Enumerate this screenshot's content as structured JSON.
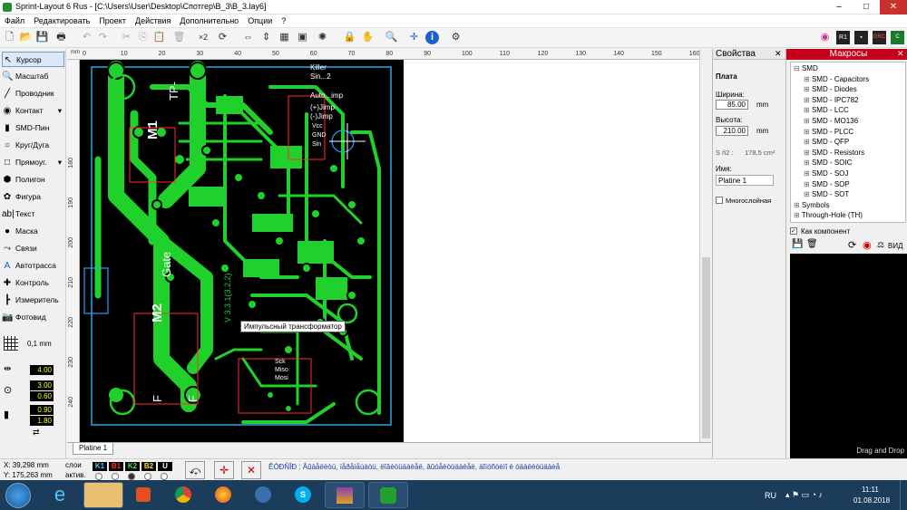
{
  "window": {
    "title": "Sprint-Layout 6 Rus - [C:\\Users\\User\\Desktop\\Спотгер\\B_3\\B_3.lay6]"
  },
  "menu": [
    "Файл",
    "Редактировать",
    "Проект",
    "Действия",
    "Дополнительно",
    "Опции",
    "?"
  ],
  "toolbar": {
    "repeat_label": "×2"
  },
  "tools": [
    {
      "label": "Курсор",
      "icon": "cursor-icon",
      "glyph": "↖"
    },
    {
      "label": "Масштаб",
      "icon": "zoom-icon",
      "glyph": "🔍"
    },
    {
      "label": "Проводник",
      "icon": "track-icon",
      "glyph": "╱"
    },
    {
      "label": "Контакт",
      "icon": "pad-icon",
      "glyph": "◉"
    },
    {
      "label": "SMD-Пин",
      "icon": "smd-pin-icon",
      "glyph": "▮"
    },
    {
      "label": "Круг/Дуга",
      "icon": "circle-icon",
      "glyph": "○"
    },
    {
      "label": "Прямоуг.",
      "icon": "rectangle-icon",
      "glyph": "□"
    },
    {
      "label": "Полигон",
      "icon": "polygon-icon",
      "glyph": "⬢"
    },
    {
      "label": "Фигура",
      "icon": "shape-icon",
      "glyph": "✿"
    },
    {
      "label": "Текст",
      "icon": "text-icon",
      "glyph": "ab|"
    },
    {
      "label": "Маска",
      "icon": "mask-icon",
      "glyph": "●"
    },
    {
      "label": "Связи",
      "icon": "connections-icon",
      "glyph": "⤳"
    },
    {
      "label": "Автотрасса",
      "icon": "autoroute-icon",
      "glyph": "A"
    },
    {
      "label": "Контроль",
      "icon": "check-icon",
      "glyph": "✚"
    },
    {
      "label": "Измеритель",
      "icon": "measure-icon",
      "glyph": "┣"
    },
    {
      "label": "Фотовид",
      "icon": "photoview-icon",
      "glyph": "📷"
    }
  ],
  "grid": {
    "value": "0,1 mm"
  },
  "track_width": "4.00",
  "pad_sizes": [
    "3.00",
    "0.60"
  ],
  "smd_sizes": [
    "0.90",
    "1.80"
  ],
  "ruler": {
    "top": [
      "0",
      "10",
      "20",
      "30",
      "40",
      "50",
      "60",
      "70",
      "80",
      "90",
      "100",
      "110",
      "120",
      "130",
      "140",
      "150",
      "160"
    ],
    "left": [
      "180",
      "190",
      "200",
      "210",
      "220",
      "230",
      "240"
    ]
  },
  "pcb_labels": {
    "m1": "M1",
    "m2": "M2",
    "gate": "Gate",
    "tp": "TP-",
    "f1": "F",
    "f2": "F",
    "killer": "Killer",
    "sin": "Sin...2",
    "auto": "Auto...imp",
    "jimp1": "(+)Jimp",
    "jimp2": "(-)Jimp",
    "vcc": "Vcc",
    "gnd": "GND",
    "sin2": "Sin",
    "version": "V 3.3.1(3.2.2)",
    "sck": "Sck",
    "miso": "Miso",
    "mosi": "Mosi"
  },
  "tooltip": "Импульсный трансформатор",
  "tab": "Platine 1",
  "props": {
    "title": "Свойства",
    "section": "Плата",
    "width_label": "Ширина:",
    "width_value": "85.00",
    "width_unit": "mm",
    "height_label": "Высота:",
    "height_value": "210.00",
    "height_unit": "mm",
    "area_label": "S ñ2 :",
    "area_value": "178,5 cm²",
    "name_label": "Имя:",
    "name_value": "Platine 1",
    "multilayer": "Многослойная"
  },
  "macros": {
    "title": "Макросы",
    "tree": [
      {
        "label": "SMD",
        "level": 0
      },
      {
        "label": "SMD - Capacitors",
        "level": 1
      },
      {
        "label": "SMD - Diodes",
        "level": 1
      },
      {
        "label": "SMD - IPC782",
        "level": 1
      },
      {
        "label": "SMD - LCC",
        "level": 1
      },
      {
        "label": "SMD - MO136",
        "level": 1
      },
      {
        "label": "SMD - PLCC",
        "level": 1
      },
      {
        "label": "SMD - QFP",
        "level": 1
      },
      {
        "label": "SMD - Resistors",
        "level": 1
      },
      {
        "label": "SMD - SOIC",
        "level": 1
      },
      {
        "label": "SMD - SOJ",
        "level": 1
      },
      {
        "label": "SMD - SOP",
        "level": 1
      },
      {
        "label": "SMD - SOT",
        "level": 1
      },
      {
        "label": "Symbols",
        "level": 0
      },
      {
        "label": "Through-Hole (TH)",
        "level": 0
      }
    ],
    "as_component": "Как компонент",
    "view": "ВИД",
    "drag_drop": "Drag and Drop"
  },
  "status": {
    "x": "X:  39,298 mm",
    "y": "Y: 175,263 mm",
    "layer_label": "слои",
    "active_label": "актив.",
    "layers": [
      {
        "n": "K1",
        "c": "#3ad0ff"
      },
      {
        "n": "B1",
        "c": "#ff3030"
      },
      {
        "n": "K2",
        "c": "#40e040"
      },
      {
        "n": "B2",
        "c": "#ffe000"
      },
      {
        "n": "U",
        "c": "#ffffff"
      }
    ],
    "hint": "ÊÓÐÑÎÐ : Âûäåëèòü, ïåðåìåùàòü, ëîâèòüäàèåë, âûóåèòüäàèåë, äîïóñòèìî è óäàëèòüäàèå"
  },
  "taskbar": {
    "lang": "RU",
    "time": "11:11",
    "date": "01.08.2018"
  }
}
